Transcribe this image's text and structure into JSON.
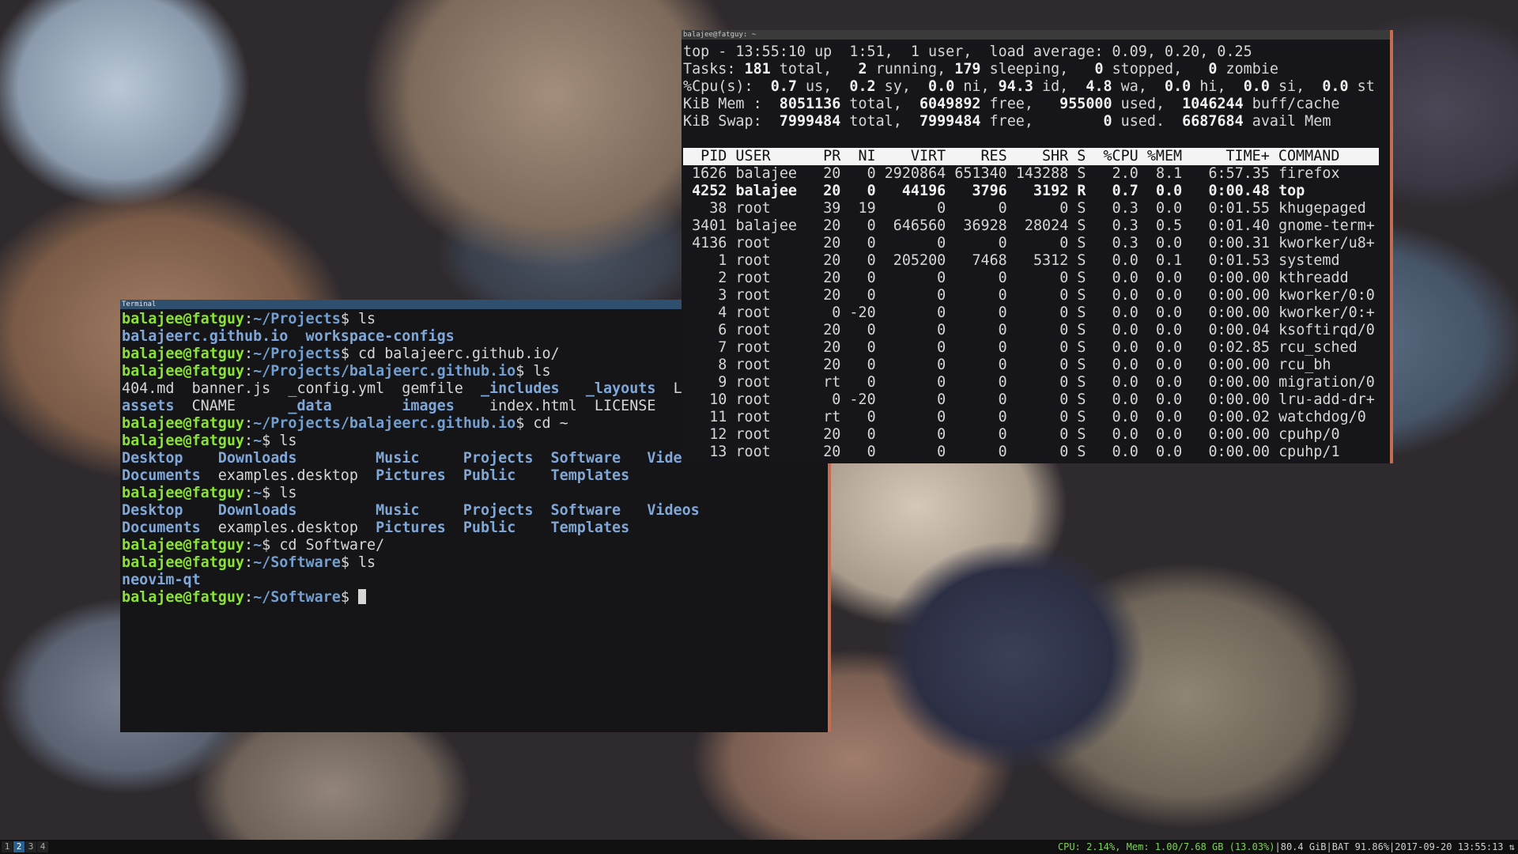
{
  "terminal": {
    "title": "Terminal",
    "prompt": "balajee@fatguy",
    "lines": [
      [
        {
          "t": "balajee@fatguy",
          "c": "pr"
        },
        {
          "t": ":"
        },
        {
          "t": "~/Projects",
          "c": "pt"
        },
        {
          "t": "$ ls"
        }
      ],
      [
        {
          "t": "balajeerc.github.io  workspace-configs",
          "c": "di"
        }
      ],
      [
        {
          "t": "balajee@fatguy",
          "c": "pr"
        },
        {
          "t": ":"
        },
        {
          "t": "~/Projects",
          "c": "pt"
        },
        {
          "t": "$ cd balajeerc.github.io/"
        }
      ],
      [
        {
          "t": "balajee@fatguy",
          "c": "pr"
        },
        {
          "t": ":"
        },
        {
          "t": "~/Projects/balajeerc.github.io",
          "c": "pt"
        },
        {
          "t": "$ ls"
        }
      ],
      [
        {
          "t": "404.md  banner.js  _config.yml  gemfile  "
        },
        {
          "t": "_includes",
          "c": "di"
        },
        {
          "t": "   "
        },
        {
          "t": "_layouts",
          "c": "di"
        },
        {
          "t": "  Li"
        }
      ],
      [
        {
          "t": "assets",
          "c": "di"
        },
        {
          "t": "  CNAME      "
        },
        {
          "t": "_data",
          "c": "di"
        },
        {
          "t": "        "
        },
        {
          "t": "images",
          "c": "di"
        },
        {
          "t": "    index.html  LICENSE    "
        },
        {
          "t": "_",
          "c": "di"
        }
      ],
      [
        {
          "t": "balajee@fatguy",
          "c": "pr"
        },
        {
          "t": ":"
        },
        {
          "t": "~/Projects/balajeerc.github.io",
          "c": "pt"
        },
        {
          "t": "$ cd ~"
        }
      ],
      [
        {
          "t": "balajee@fatguy",
          "c": "pr"
        },
        {
          "t": ":"
        },
        {
          "t": "~",
          "c": "pt"
        },
        {
          "t": "$ ls"
        }
      ],
      [
        {
          "t": "Desktop    Downloads         Music     Projects  Software   Videos",
          "c": "di"
        }
      ],
      [
        {
          "t": "Documents",
          "c": "di"
        },
        {
          "t": "  examples.desktop  "
        },
        {
          "t": "Pictures  Public    Templates",
          "c": "di"
        }
      ],
      [
        {
          "t": "balajee@fatguy",
          "c": "pr"
        },
        {
          "t": ":"
        },
        {
          "t": "~",
          "c": "pt"
        },
        {
          "t": "$ ls"
        }
      ],
      [
        {
          "t": "Desktop    Downloads         Music     Projects  Software   Videos",
          "c": "di"
        }
      ],
      [
        {
          "t": "Documents",
          "c": "di"
        },
        {
          "t": "  examples.desktop  "
        },
        {
          "t": "Pictures  Public    Templates",
          "c": "di"
        }
      ],
      [
        {
          "t": "balajee@fatguy",
          "c": "pr"
        },
        {
          "t": ":"
        },
        {
          "t": "~",
          "c": "pt"
        },
        {
          "t": "$ cd Software/"
        }
      ],
      [
        {
          "t": "balajee@fatguy",
          "c": "pr"
        },
        {
          "t": ":"
        },
        {
          "t": "~/Software",
          "c": "pt"
        },
        {
          "t": "$ ls"
        }
      ],
      [
        {
          "t": "neovim-qt",
          "c": "di"
        }
      ],
      [
        {
          "t": "balajee@fatguy",
          "c": "pr"
        },
        {
          "t": ":"
        },
        {
          "t": "~/Software",
          "c": "pt"
        },
        {
          "t": "$ "
        },
        {
          "cursor": true
        }
      ]
    ]
  },
  "top": {
    "title": "balajee@fatguy: ~",
    "summary": [
      [
        {
          "t": "top - 13:55:10 up  1:51,  1 user,  load average: 0.09, 0.20, 0.25"
        }
      ],
      [
        {
          "t": "Tasks: "
        },
        {
          "t": "181",
          "c": "b"
        },
        {
          "t": " total,   "
        },
        {
          "t": "2",
          "c": "b"
        },
        {
          "t": " running, "
        },
        {
          "t": "179",
          "c": "b"
        },
        {
          "t": " sleeping,   "
        },
        {
          "t": "0",
          "c": "b"
        },
        {
          "t": " stopped,   "
        },
        {
          "t": "0",
          "c": "b"
        },
        {
          "t": " zombie"
        }
      ],
      [
        {
          "t": "%Cpu(s):  "
        },
        {
          "t": "0.7",
          "c": "b"
        },
        {
          "t": " us,  "
        },
        {
          "t": "0.2",
          "c": "b"
        },
        {
          "t": " sy,  "
        },
        {
          "t": "0.0",
          "c": "b"
        },
        {
          "t": " ni, "
        },
        {
          "t": "94.3",
          "c": "b"
        },
        {
          "t": " id,  "
        },
        {
          "t": "4.8",
          "c": "b"
        },
        {
          "t": " wa,  "
        },
        {
          "t": "0.0",
          "c": "b"
        },
        {
          "t": " hi,  "
        },
        {
          "t": "0.0",
          "c": "b"
        },
        {
          "t": " si,  "
        },
        {
          "t": "0.0",
          "c": "b"
        },
        {
          "t": " st"
        }
      ],
      [
        {
          "t": "KiB Mem :  "
        },
        {
          "t": "8051136",
          "c": "b"
        },
        {
          "t": " total,  "
        },
        {
          "t": "6049892",
          "c": "b"
        },
        {
          "t": " free,   "
        },
        {
          "t": "955000",
          "c": "b"
        },
        {
          "t": " used,  "
        },
        {
          "t": "1046244",
          "c": "b"
        },
        {
          "t": " buff/cache"
        }
      ],
      [
        {
          "t": "KiB Swap:  "
        },
        {
          "t": "7999484",
          "c": "b"
        },
        {
          "t": " total,  "
        },
        {
          "t": "7999484",
          "c": "b"
        },
        {
          "t": " free,        "
        },
        {
          "t": "0",
          "c": "b"
        },
        {
          "t": " used.  "
        },
        {
          "t": "6687684",
          "c": "b"
        },
        {
          "t": " avail Mem"
        }
      ]
    ],
    "header": "  PID USER      PR  NI    VIRT    RES    SHR S  %CPU %MEM     TIME+ COMMAND     ",
    "processes": [
      {
        "pid": "1626",
        "user": "balajee",
        "pr": "20",
        "ni": "0",
        "virt": "2920864",
        "res": "651340",
        "shr": "143288",
        "s": "S",
        "cpu": "2.0",
        "mem": "8.1",
        "time": "6:57.35",
        "cmd": "firefox"
      },
      {
        "pid": "4252",
        "user": "balajee",
        "pr": "20",
        "ni": "0",
        "virt": "44196",
        "res": "3796",
        "shr": "3192",
        "s": "R",
        "cpu": "0.7",
        "mem": "0.0",
        "time": "0:00.48",
        "cmd": "top",
        "bold": true
      },
      {
        "pid": "38",
        "user": "root",
        "pr": "39",
        "ni": "19",
        "virt": "0",
        "res": "0",
        "shr": "0",
        "s": "S",
        "cpu": "0.3",
        "mem": "0.0",
        "time": "0:01.55",
        "cmd": "khugepaged"
      },
      {
        "pid": "3401",
        "user": "balajee",
        "pr": "20",
        "ni": "0",
        "virt": "646560",
        "res": "36928",
        "shr": "28024",
        "s": "S",
        "cpu": "0.3",
        "mem": "0.5",
        "time": "0:01.40",
        "cmd": "gnome-term+"
      },
      {
        "pid": "4136",
        "user": "root",
        "pr": "20",
        "ni": "0",
        "virt": "0",
        "res": "0",
        "shr": "0",
        "s": "S",
        "cpu": "0.3",
        "mem": "0.0",
        "time": "0:00.31",
        "cmd": "kworker/u8+"
      },
      {
        "pid": "1",
        "user": "root",
        "pr": "20",
        "ni": "0",
        "virt": "205200",
        "res": "7468",
        "shr": "5312",
        "s": "S",
        "cpu": "0.0",
        "mem": "0.1",
        "time": "0:01.53",
        "cmd": "systemd"
      },
      {
        "pid": "2",
        "user": "root",
        "pr": "20",
        "ni": "0",
        "virt": "0",
        "res": "0",
        "shr": "0",
        "s": "S",
        "cpu": "0.0",
        "mem": "0.0",
        "time": "0:00.00",
        "cmd": "kthreadd"
      },
      {
        "pid": "3",
        "user": "root",
        "pr": "20",
        "ni": "0",
        "virt": "0",
        "res": "0",
        "shr": "0",
        "s": "S",
        "cpu": "0.0",
        "mem": "0.0",
        "time": "0:00.00",
        "cmd": "kworker/0:0"
      },
      {
        "pid": "4",
        "user": "root",
        "pr": "0",
        "ni": "-20",
        "virt": "0",
        "res": "0",
        "shr": "0",
        "s": "S",
        "cpu": "0.0",
        "mem": "0.0",
        "time": "0:00.00",
        "cmd": "kworker/0:+"
      },
      {
        "pid": "6",
        "user": "root",
        "pr": "20",
        "ni": "0",
        "virt": "0",
        "res": "0",
        "shr": "0",
        "s": "S",
        "cpu": "0.0",
        "mem": "0.0",
        "time": "0:00.04",
        "cmd": "ksoftirqd/0"
      },
      {
        "pid": "7",
        "user": "root",
        "pr": "20",
        "ni": "0",
        "virt": "0",
        "res": "0",
        "shr": "0",
        "s": "S",
        "cpu": "0.0",
        "mem": "0.0",
        "time": "0:02.85",
        "cmd": "rcu_sched"
      },
      {
        "pid": "8",
        "user": "root",
        "pr": "20",
        "ni": "0",
        "virt": "0",
        "res": "0",
        "shr": "0",
        "s": "S",
        "cpu": "0.0",
        "mem": "0.0",
        "time": "0:00.00",
        "cmd": "rcu_bh"
      },
      {
        "pid": "9",
        "user": "root",
        "pr": "rt",
        "ni": "0",
        "virt": "0",
        "res": "0",
        "shr": "0",
        "s": "S",
        "cpu": "0.0",
        "mem": "0.0",
        "time": "0:00.00",
        "cmd": "migration/0"
      },
      {
        "pid": "10",
        "user": "root",
        "pr": "0",
        "ni": "-20",
        "virt": "0",
        "res": "0",
        "shr": "0",
        "s": "S",
        "cpu": "0.0",
        "mem": "0.0",
        "time": "0:00.00",
        "cmd": "lru-add-dr+"
      },
      {
        "pid": "11",
        "user": "root",
        "pr": "rt",
        "ni": "0",
        "virt": "0",
        "res": "0",
        "shr": "0",
        "s": "S",
        "cpu": "0.0",
        "mem": "0.0",
        "time": "0:00.02",
        "cmd": "watchdog/0"
      },
      {
        "pid": "12",
        "user": "root",
        "pr": "20",
        "ni": "0",
        "virt": "0",
        "res": "0",
        "shr": "0",
        "s": "S",
        "cpu": "0.0",
        "mem": "0.0",
        "time": "0:00.00",
        "cmd": "cpuhp/0"
      },
      {
        "pid": "13",
        "user": "root",
        "pr": "20",
        "ni": "0",
        "virt": "0",
        "res": "0",
        "shr": "0",
        "s": "S",
        "cpu": "0.0",
        "mem": "0.0",
        "time": "0:00.00",
        "cmd": "cpuhp/1"
      }
    ]
  },
  "statusbar": {
    "workspaces": [
      "1",
      "2",
      "3",
      "4"
    ],
    "active_workspace": "2",
    "cpu": "CPU: 2.14%, Mem: 1.00/7.68 GB (13.03%)",
    "disk": "80.4 GiB",
    "battery": "BAT 91.86%",
    "datetime": "2017-09-20 13:55:13",
    "tray_icon": "network-arrows-icon"
  },
  "colors": {
    "prompt_user": "#8ae234",
    "prompt_path": "#729fcf",
    "dir": "#7fa7d8",
    "window_border": "#c56b4e"
  }
}
